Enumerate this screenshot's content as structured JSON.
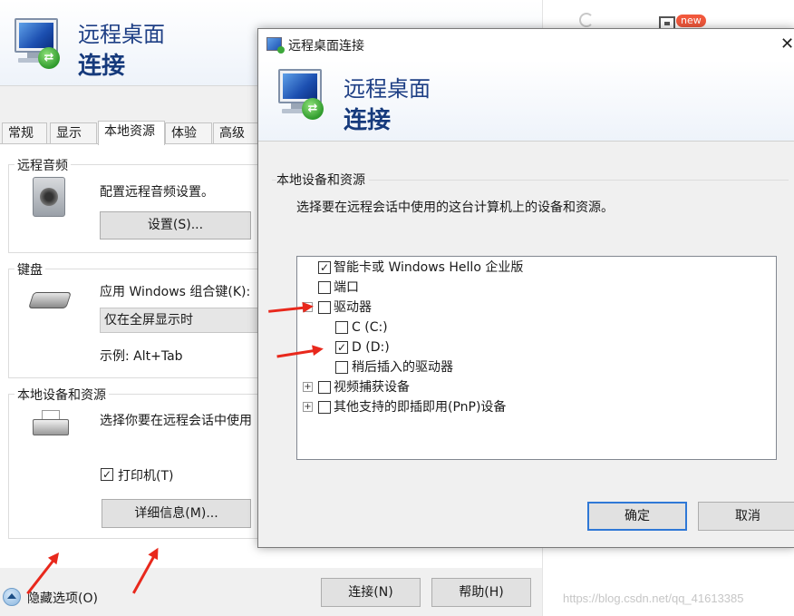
{
  "browser": {
    "badge": "new",
    "icons": [
      "refresh-icon",
      "grid-icon"
    ]
  },
  "main_window": {
    "header": {
      "title_line1": "远程桌面",
      "title_line2": "连接"
    },
    "tabs": [
      {
        "label": "常规"
      },
      {
        "label": "显示"
      },
      {
        "label": "本地资源",
        "active": true
      },
      {
        "label": "体验"
      },
      {
        "label": "高级"
      }
    ],
    "remote_audio": {
      "title": "远程音频",
      "description": "配置远程音频设置。",
      "button": "设置(S)..."
    },
    "keyboard": {
      "title": "键盘",
      "description": "应用 Windows 组合键(K):",
      "selected": "仅在全屏显示时",
      "example": "示例: Alt+Tab"
    },
    "local_devices": {
      "title": "本地设备和资源",
      "description": "选择你要在远程会话中使用",
      "printers_label": "打印机(T)",
      "printers_checked": true,
      "details_button": "详细信息(M)..."
    },
    "footer": {
      "hide_options": "隐藏选项(O)",
      "connect": "连接(N)",
      "help": "帮助(H)"
    }
  },
  "dialog": {
    "window_title": "远程桌面连接",
    "close_glyph": "✕",
    "header": {
      "title_line1": "远程桌面",
      "title_line2": "连接"
    },
    "section_title": "本地设备和资源",
    "instruction": "选择要在远程会话中使用的这台计算机上的设备和资源。",
    "items": [
      {
        "label": "智能卡或 Windows Hello 企业版",
        "checked": true,
        "level": 0
      },
      {
        "label": "端口",
        "checked": false,
        "level": 0
      },
      {
        "label": "驱动器",
        "checked": false,
        "level": 0,
        "expanded": true
      },
      {
        "label": "C (C:)",
        "checked": false,
        "level": 1
      },
      {
        "label": "D (D:)",
        "checked": true,
        "level": 1
      },
      {
        "label": "稍后插入的驱动器",
        "checked": false,
        "level": 1
      },
      {
        "label": "视频捕获设备",
        "checked": false,
        "level": 0,
        "collapsed": true
      },
      {
        "label": "其他支持的即插即用(PnP)设备",
        "checked": false,
        "level": 0,
        "collapsed": true
      }
    ],
    "ok": "确定",
    "cancel": "取消"
  },
  "watermark": "https://blog.csdn.net/qq_41613385",
  "colors": {
    "accent": "#1e3f85",
    "annotation_arrow": "#e8281c",
    "focus_border": "#2f78d6"
  }
}
